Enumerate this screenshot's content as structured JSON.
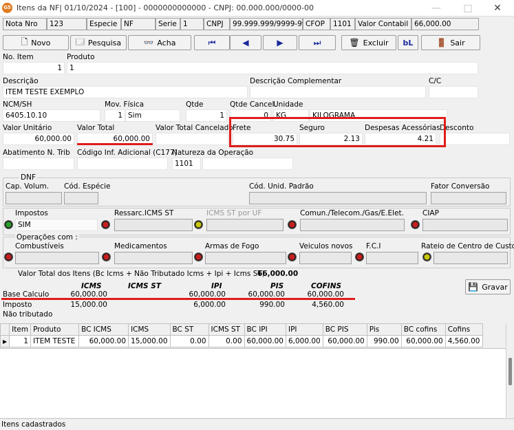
{
  "window": {
    "title": "Itens da NF| 01/10/2024 - [100] - 0000000000000 - CNPJ: 00.000.000/0000-00",
    "logo": "G5",
    "minimize": "—",
    "maximize": "□",
    "close": "✕"
  },
  "header": {
    "nota_label": "Nota Nro",
    "nota": "123",
    "especie_label": "Especie",
    "especie": "NF",
    "serie_label": "Serie",
    "serie": "1",
    "cnpj_label": "CNPJ",
    "cnpj": "99.999.999/9999-99",
    "cfop_label": "CFOP",
    "cfop": "1101",
    "valor_contabil_label": "Valor Contabil",
    "valor_contabil": "66,000.00"
  },
  "toolbar": {
    "novo": "Novo",
    "pesquisa": "Pesquisa",
    "acha": "Acha",
    "first": "⏮",
    "prev": "◀",
    "next": "▶",
    "last": "⏭",
    "excluir": "Excluir",
    "bl": "bL",
    "sair": "Sair"
  },
  "form": {
    "no_item_label": "No. Item",
    "no_item": "1",
    "produto_label": "Produto",
    "produto": "1",
    "descricao_label": "Descrição",
    "descricao": "ITEM TESTE EXEMPLO",
    "desc_compl_label": "Descrição Complementar",
    "desc_compl": "",
    "cc_label": "C/C",
    "cc": "",
    "ncm_label": "NCM/SH",
    "ncm": "6405.10.10",
    "mov_label": "Mov. Física",
    "mov_num": "1",
    "mov_val": "Sim",
    "qtde_label": "Qtde",
    "qtde": "1",
    "qtde_canc_label": "Qtde Cancel.",
    "qtde_canc": "0",
    "unidade_label": "Unidade",
    "unidade": "KG",
    "unidade_desc": "KILOGRAMA",
    "valor_unit_label": "Valor Unitário",
    "valor_unit": "60,000.00",
    "valor_total_label": "Valor Total",
    "valor_total": "60,000.00",
    "valor_total_canc_label": "Valor Total Cancelado",
    "valor_total_canc": "",
    "frete_label": "Frete",
    "frete": "30.75",
    "seguro_label": "Seguro",
    "seguro": "2.13",
    "despesas_label": "Despesas Acessórias",
    "despesas": "4.21",
    "desconto_label": "Desconto",
    "desconto": "",
    "abatimento_label": "Abatimento N. Trib",
    "abatimento": "",
    "cod_inf_label": "Código Inf. Adicional (C177)",
    "cod_inf": "",
    "natureza_label": "Natureza da Operação",
    "natureza": "1101"
  },
  "dnf": {
    "title": "DNF",
    "cap_volum": "Cap. Volum.",
    "cod_especie": "Cód. Espécie",
    "cod_unid": "Cód. Unid. Padrão",
    "fator": "Fator Conversão"
  },
  "impostos": {
    "impostos_label": "Impostos",
    "impostos_val": "SIM",
    "ressarc_label": "Ressarc.ICMS ST",
    "icms_st_uf_label": "ICMS ST por UF",
    "comun_label": "Comun./Telecom./Gas/E.Elet.",
    "ciap_label": "CIAP"
  },
  "operacoes": {
    "title": "Operações com :",
    "combustiveis": "Combustíveis",
    "medicamentos": "Medicamentos",
    "armas": "Armas de Fogo",
    "veiculos": "Veiculos novos",
    "fci": "F.C.I",
    "rateio": "Rateio de Centro de Custo"
  },
  "totais": {
    "label": "Valor Total dos Itens  (Bc Icms + Não Tributado Icms + Ipi + Icms ST)",
    "valor": "66,000.00",
    "headers": [
      "ICMS",
      "ICMS ST",
      "IPI",
      "PIS",
      "COFINS"
    ],
    "base_label": "Base Calculo",
    "base": [
      "60,000.00",
      "",
      "60,000.00",
      "60,000.00",
      "60,000.00"
    ],
    "imposto_label": "Imposto",
    "imposto": [
      "15,000.00",
      "",
      "6,000.00",
      "990.00",
      "4,560.00"
    ],
    "nao_trib_label": "Não tributado",
    "gravar": "Gravar"
  },
  "grid": {
    "columns": [
      "Item",
      "Produto",
      "BC ICMS",
      "ICMS",
      "BC ST",
      "ICMS ST",
      "BC IPI",
      "IPI",
      "BC PIS",
      "Pis",
      "BC cofins",
      "Cofins"
    ],
    "rows": [
      [
        "1",
        "ITEM TESTE",
        "60,000.00",
        "15,000.00",
        "0.00",
        "0.00",
        "60,000.00",
        "6,000.00",
        "60,000.00",
        "990.00",
        "60,000.00",
        "4,560.00"
      ]
    ],
    "row_pointer": "▶"
  },
  "status": "Itens cadastrados",
  "colors": {
    "highlight": "#e01b1b",
    "background": "#f0f0f0"
  }
}
